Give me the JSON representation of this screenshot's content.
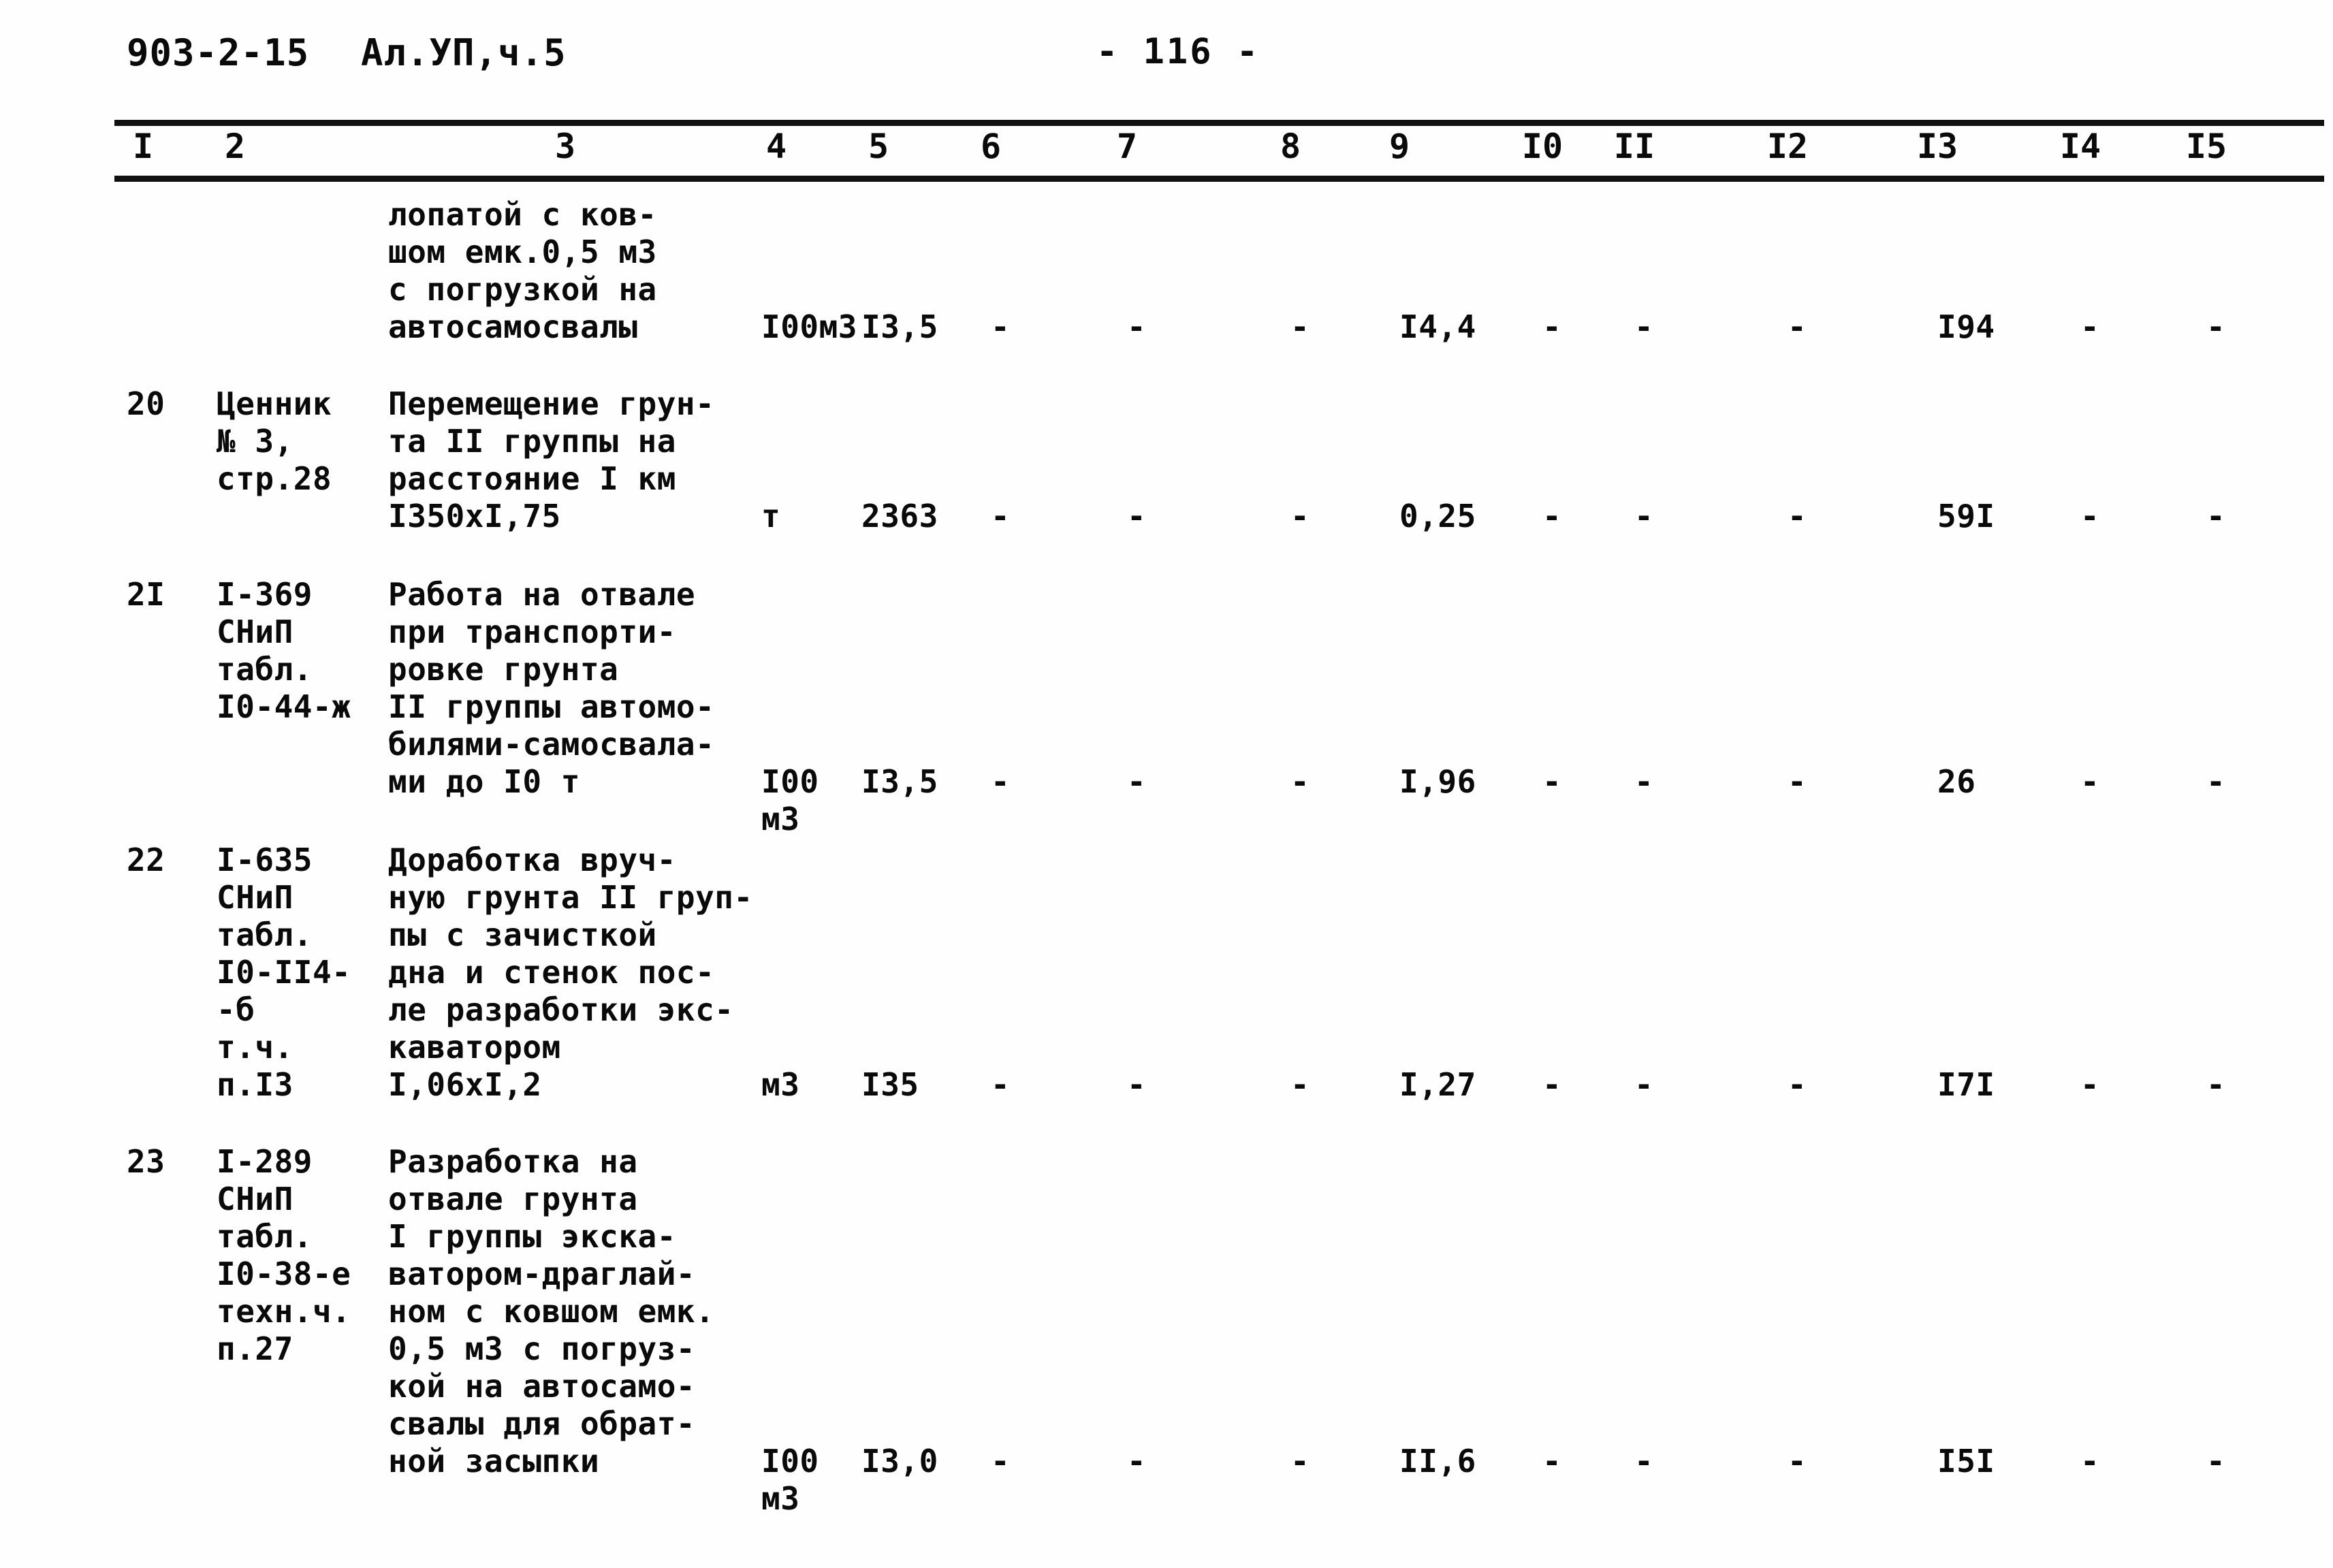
{
  "header": {
    "doc_code": "903-2-15",
    "album": "Ал.УП,ч.5",
    "page_label": "- 116 -"
  },
  "table": {
    "column_headers": [
      "I",
      "2",
      "3",
      "4",
      "5",
      "6",
      "7",
      "8",
      "9",
      "I0",
      "II",
      "I2",
      "I3",
      "I4",
      "I5"
    ],
    "rows": [
      {
        "number": "",
        "justification": "",
        "description": "лопатой с ков-\nшом емк.0,5 м3\nс погрузкой на\nавтосамосвалы",
        "unit": "I00м3",
        "quantity": "I3,5",
        "col6": "-",
        "col7": "-",
        "col8": "-",
        "col9": "I4,4",
        "col10": "-",
        "col11": "-",
        "col12": "-",
        "col13": "I94",
        "col14": "-",
        "col15": "-"
      },
      {
        "number": "20",
        "justification": "Ценник\n№ 3,\nстр.28",
        "description": "Перемещение грун-\nта II группы на\nрасстояние I км\nI350xI,75",
        "unit": "т",
        "quantity": "2363",
        "col6": "-",
        "col7": "-",
        "col8": "-",
        "col9": "0,25",
        "col10": "-",
        "col11": "-",
        "col12": "-",
        "col13": "59I",
        "col14": "-",
        "col15": "-"
      },
      {
        "number": "2I",
        "justification": "I-369\nСНиП\nтабл.\nI0-44-ж",
        "description": "Работа на отвале\nпри транспорти-\nровке грунта\nII группы автомо-\nбилями-самосвала-\nми до I0 т",
        "unit": "I00\nм3",
        "quantity": "I3,5",
        "col6": "-",
        "col7": "-",
        "col8": "-",
        "col9": "I,96",
        "col10": "-",
        "col11": "-",
        "col12": "-",
        "col13": "26",
        "col14": "-",
        "col15": "-"
      },
      {
        "number": "22",
        "justification": "I-635\nСНиП\nтабл.\nI0-II4-\n-б\nт.ч.\nп.I3",
        "description": "Доработка вруч-\nную грунта II груп-\nпы с зачисткой\nдна и стенок пос-\nле разработки экс-\nкаватором\nI,06xI,2",
        "unit": "м3",
        "quantity": "I35",
        "col6": "-",
        "col7": "-",
        "col8": "-",
        "col9": "I,27",
        "col10": "-",
        "col11": "-",
        "col12": "-",
        "col13": "I7I",
        "col14": "-",
        "col15": "-"
      },
      {
        "number": "23",
        "justification": "I-289\nСНиП\nтабл.\nI0-38-е\nтехн.ч.\nп.27",
        "description": "Разработка на\nотвале грунта\nI группы экска-\nватором-драглай-\nном с ковшом емк.\n0,5 м3 с погруз-\nкой на автосамо-\nсвалы для обрат-\nной засыпки",
        "unit": "I00\nм3",
        "quantity": "I3,0",
        "col6": "-",
        "col7": "-",
        "col8": "-",
        "col9": "II,6",
        "col10": "-",
        "col11": "-",
        "col12": "-",
        "col13": "I5I",
        "col14": "-",
        "col15": "-"
      }
    ]
  }
}
